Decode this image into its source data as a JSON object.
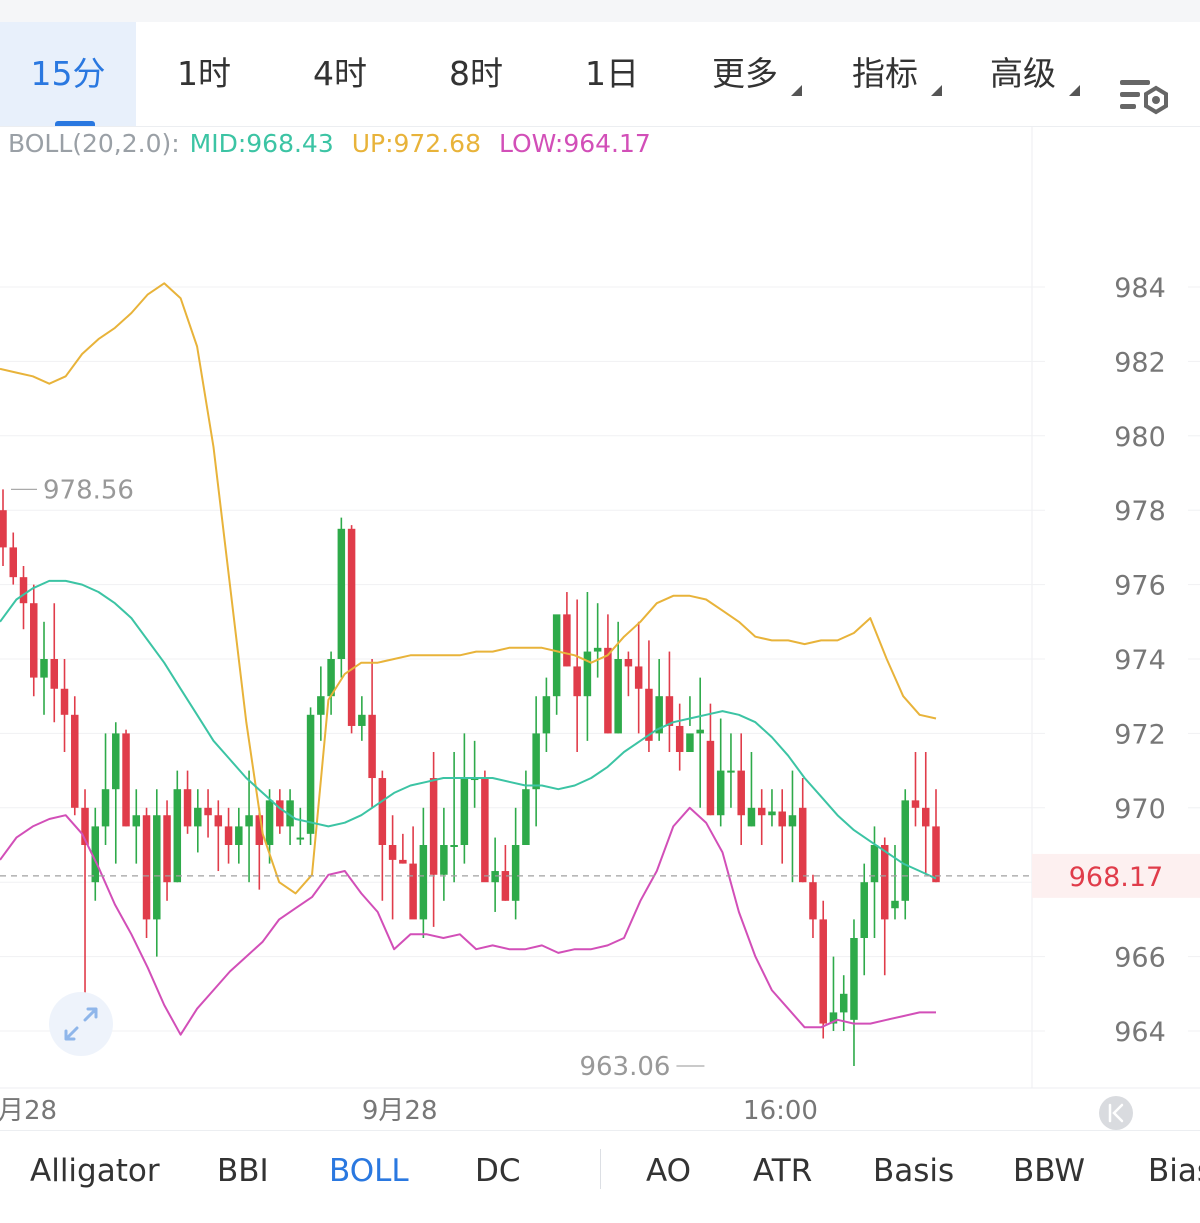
{
  "timeframes": [
    {
      "label": "15分",
      "active": true
    },
    {
      "label": "1时"
    },
    {
      "label": "4时"
    },
    {
      "label": "8时"
    },
    {
      "label": "1日"
    },
    {
      "label": "更多",
      "dropdown": true
    },
    {
      "label": "指标",
      "dropdown": true
    },
    {
      "label": "高级",
      "dropdown": true
    }
  ],
  "settings_icon": "chart-settings-icon",
  "legend": {
    "name": "BOLL(20,2.0):",
    "mid": "MID:968.43",
    "up": "UP:972.68",
    "low": "LOW:964.17",
    "colors": {
      "name": "#9aa0a6",
      "mid": "#3cc4a4",
      "up": "#e8b33a",
      "low": "#d24fb8"
    }
  },
  "chart_data": {
    "type": "candlestick",
    "indicator": "BOLL(20,2.0)",
    "y_ticks": [
      964,
      966,
      968,
      970,
      972,
      974,
      976,
      978,
      980,
      982,
      984
    ],
    "y_tick_labels": [
      "964",
      "966",
      "968",
      "970",
      "972",
      "974",
      "976",
      "978",
      "980",
      "982",
      "984"
    ],
    "ylim": [
      962.4,
      988.3
    ],
    "x_labels": [
      "月28",
      "9月28",
      "16:00"
    ],
    "x_label_index": [
      0,
      33,
      65
    ],
    "current_price": 968.17,
    "current_price_label": "968.17",
    "max_marker": {
      "value": 978.56,
      "label": "978.56",
      "index": 0
    },
    "min_marker": {
      "value": 963.06,
      "label": "963.06",
      "index": 69
    },
    "colors": {
      "up": "#2eaa4a",
      "down": "#e03c4a",
      "mid": "#3cc4a4",
      "upper": "#e8b33a",
      "lower": "#d24fb8",
      "price_line": "#a0a0a0"
    },
    "candles": [
      [
        978.0,
        978.56,
        976.5,
        977.0
      ],
      [
        977.0,
        977.4,
        976.0,
        976.2
      ],
      [
        976.2,
        976.5,
        974.8,
        975.5
      ],
      [
        975.5,
        976.0,
        973.0,
        973.5
      ],
      [
        973.5,
        975.0,
        972.5,
        974.0
      ],
      [
        974.0,
        975.5,
        972.3,
        973.2
      ],
      [
        973.2,
        974.0,
        971.5,
        972.5
      ],
      [
        972.5,
        973.0,
        969.8,
        970.0
      ],
      [
        970.0,
        970.5,
        965.0,
        969.0
      ],
      [
        968.0,
        970.0,
        967.5,
        969.5
      ],
      [
        969.5,
        972.0,
        969.0,
        970.5
      ],
      [
        970.5,
        972.3,
        968.5,
        972.0
      ],
      [
        972.0,
        972.1,
        969.5,
        969.5
      ],
      [
        969.5,
        970.5,
        968.5,
        969.8
      ],
      [
        969.8,
        970.0,
        966.5,
        967.0
      ],
      [
        967.0,
        970.5,
        966.0,
        969.8
      ],
      [
        969.8,
        970.2,
        967.5,
        968.0
      ],
      [
        968.0,
        971.0,
        968.0,
        970.5
      ],
      [
        970.5,
        971.0,
        969.3,
        969.5
      ],
      [
        969.5,
        970.5,
        968.8,
        970.0
      ],
      [
        970.0,
        970.5,
        969.2,
        969.8
      ],
      [
        969.8,
        970.2,
        968.3,
        969.5
      ],
      [
        969.5,
        970.0,
        968.5,
        969.0
      ],
      [
        969.0,
        970.0,
        968.5,
        969.5
      ],
      [
        969.5,
        971.0,
        968.0,
        969.8
      ],
      [
        969.8,
        970.0,
        967.8,
        969.0
      ],
      [
        969.0,
        970.5,
        968.5,
        970.2
      ],
      [
        970.2,
        970.5,
        969.3,
        969.5
      ],
      [
        969.5,
        970.5,
        969.0,
        970.2
      ],
      [
        969.2,
        970.0,
        969.0,
        969.2
      ],
      [
        969.3,
        972.7,
        969.0,
        972.5
      ],
      [
        972.5,
        973.8,
        971.8,
        973.0
      ],
      [
        973.0,
        974.2,
        972.5,
        974.0
      ],
      [
        974.0,
        977.8,
        973.5,
        977.5
      ],
      [
        977.5,
        977.6,
        972.0,
        972.2
      ],
      [
        972.2,
        973.0,
        971.8,
        972.5
      ],
      [
        972.5,
        974.0,
        970.0,
        970.8
      ],
      [
        970.8,
        971.0,
        967.5,
        969.0
      ],
      [
        969.0,
        969.8,
        967.0,
        968.6
      ],
      [
        968.6,
        969.3,
        968.5,
        968.5
      ],
      [
        968.5,
        969.5,
        967.3,
        967.0
      ],
      [
        967.0,
        970.0,
        966.5,
        969.0
      ],
      [
        970.8,
        971.5,
        966.8,
        968.2
      ],
      [
        968.2,
        970.0,
        967.5,
        969.0
      ],
      [
        969.0,
        971.5,
        968.0,
        969.0
      ],
      [
        969.0,
        972.0,
        968.5,
        970.8
      ],
      [
        970.8,
        971.8,
        970.0,
        970.8
      ],
      [
        970.8,
        971.0,
        968.5,
        968.0
      ],
      [
        968.0,
        969.2,
        967.2,
        968.3
      ],
      [
        968.3,
        969.0,
        967.5,
        967.5
      ],
      [
        967.5,
        970.0,
        967.0,
        969.0
      ],
      [
        969.0,
        971.0,
        969.0,
        970.5
      ],
      [
        970.5,
        973.0,
        969.5,
        972.0
      ],
      [
        972.0,
        973.5,
        971.5,
        973.0
      ],
      [
        973.0,
        975.0,
        972.5,
        975.2
      ],
      [
        975.2,
        975.8,
        973.8,
        973.8
      ],
      [
        973.8,
        975.6,
        971.5,
        973.0
      ],
      [
        973.0,
        975.8,
        971.8,
        974.2
      ],
      [
        974.2,
        975.5,
        973.5,
        974.3
      ],
      [
        974.3,
        975.2,
        972.0,
        972.0
      ],
      [
        972.0,
        975.0,
        972.0,
        974.0
      ],
      [
        974.0,
        974.2,
        973.0,
        973.8
      ],
      [
        973.8,
        975.0,
        972.0,
        973.2
      ],
      [
        973.2,
        974.5,
        971.5,
        971.8
      ],
      [
        972.0,
        974.0,
        971.8,
        973.0
      ],
      [
        973.0,
        974.2,
        971.5,
        972.2
      ],
      [
        972.2,
        972.8,
        971.0,
        971.5
      ],
      [
        971.5,
        973.0,
        972.2,
        972.0
      ]
    ],
    "candles_tail": [
      [
        972.0,
        973.5,
        970.0,
        972.1
      ],
      [
        971.8,
        972.8,
        969.8,
        969.8
      ],
      [
        969.8,
        972.4,
        969.5,
        971.0
      ],
      [
        971.0,
        972.0,
        970.0,
        971.0
      ],
      [
        971.0,
        972.0,
        969.0,
        969.8
      ],
      [
        969.5,
        971.5,
        969.5,
        970.0
      ],
      [
        970.0,
        970.5,
        969.0,
        969.8
      ],
      [
        969.8,
        970.5,
        969.5,
        969.9
      ],
      [
        969.9,
        970.5,
        968.5,
        969.5
      ],
      [
        969.5,
        971.0,
        968.0,
        969.8
      ],
      [
        970.0,
        970.8,
        968.0,
        968.0
      ],
      [
        968.0,
        968.2,
        966.5,
        967.0
      ],
      [
        967.0,
        967.5,
        963.8,
        964.2
      ],
      [
        964.2,
        966.0,
        964.0,
        964.5
      ],
      [
        964.5,
        965.5,
        964.0,
        965.0
      ],
      [
        964.3,
        967.0,
        963.06,
        966.5
      ],
      [
        966.5,
        968.5,
        965.5,
        968.0
      ],
      [
        968.0,
        969.5,
        966.5,
        969.0
      ],
      [
        969.0,
        969.2,
        965.5,
        967.0
      ],
      [
        967.3,
        969.0,
        967.0,
        967.5
      ],
      [
        967.5,
        970.5,
        967.0,
        970.2
      ],
      [
        970.2,
        971.5,
        969.5,
        970.0
      ],
      [
        970.0,
        971.5,
        968.2,
        969.5
      ],
      [
        969.5,
        970.5,
        968.0,
        968.0
      ]
    ],
    "boll_mid": [
      975.0,
      975.6,
      975.9,
      976.1,
      976.1,
      976.0,
      975.8,
      975.5,
      975.1,
      974.5,
      973.9,
      973.2,
      972.5,
      971.8,
      971.3,
      970.8,
      970.4,
      970.0,
      969.7,
      969.6,
      969.5,
      969.6,
      969.8,
      970.1,
      970.4,
      970.6,
      970.7,
      970.8,
      970.8,
      970.8,
      970.8,
      970.7,
      970.6,
      970.6,
      970.5,
      970.6,
      970.8,
      971.1,
      971.5,
      971.8,
      972.1,
      972.3,
      972.4,
      972.5,
      972.6,
      972.5,
      972.3,
      971.9,
      971.4,
      970.8,
      970.3,
      969.8,
      969.4,
      969.1,
      968.8,
      968.5,
      968.3,
      968.1
    ],
    "boll_upper": [
      981.8,
      981.7,
      981.6,
      981.4,
      981.6,
      982.2,
      982.6,
      982.9,
      983.3,
      983.8,
      984.1,
      983.7,
      982.4,
      979.7,
      976.0,
      972.3,
      969.3,
      968.0,
      967.7,
      968.2,
      972.9,
      973.6,
      973.9,
      973.9,
      974.0,
      974.1,
      974.1,
      974.1,
      974.1,
      974.2,
      974.2,
      974.3,
      974.3,
      974.3,
      974.2,
      974.1,
      973.9,
      974.1,
      974.6,
      975.0,
      975.5,
      975.7,
      975.7,
      975.6,
      975.3,
      975.0,
      974.6,
      974.5,
      974.5,
      974.4,
      974.5,
      974.5,
      974.7,
      975.1,
      974.0,
      973.0,
      972.5,
      972.4
    ],
    "boll_lower": [
      968.6,
      969.2,
      969.5,
      969.7,
      969.8,
      969.3,
      968.4,
      967.4,
      966.6,
      965.7,
      964.7,
      963.9,
      964.6,
      965.1,
      965.6,
      966.0,
      966.4,
      967.0,
      967.3,
      967.6,
      968.2,
      968.3,
      967.7,
      967.2,
      966.2,
      966.6,
      966.6,
      966.5,
      966.6,
      966.2,
      966.3,
      966.2,
      966.2,
      966.3,
      966.1,
      966.2,
      966.2,
      966.3,
      966.5,
      967.5,
      968.3,
      969.5,
      970.0,
      969.6,
      968.8,
      967.2,
      966.0,
      965.1,
      964.6,
      964.1,
      964.1,
      964.3,
      964.2,
      964.2,
      964.3,
      964.4,
      964.5,
      964.5
    ]
  },
  "indicators": [
    {
      "label": "Alligator"
    },
    {
      "label": "BBI"
    },
    {
      "label": "BOLL",
      "active": true
    },
    {
      "label": "DC"
    },
    {
      "label": "AO"
    },
    {
      "label": "ATR"
    },
    {
      "label": "Basis"
    },
    {
      "label": "BBW"
    },
    {
      "label": "Bias"
    }
  ],
  "icons": {
    "expand": "expand-icon",
    "scroll_to_latest": "scroll-to-latest-icon"
  }
}
